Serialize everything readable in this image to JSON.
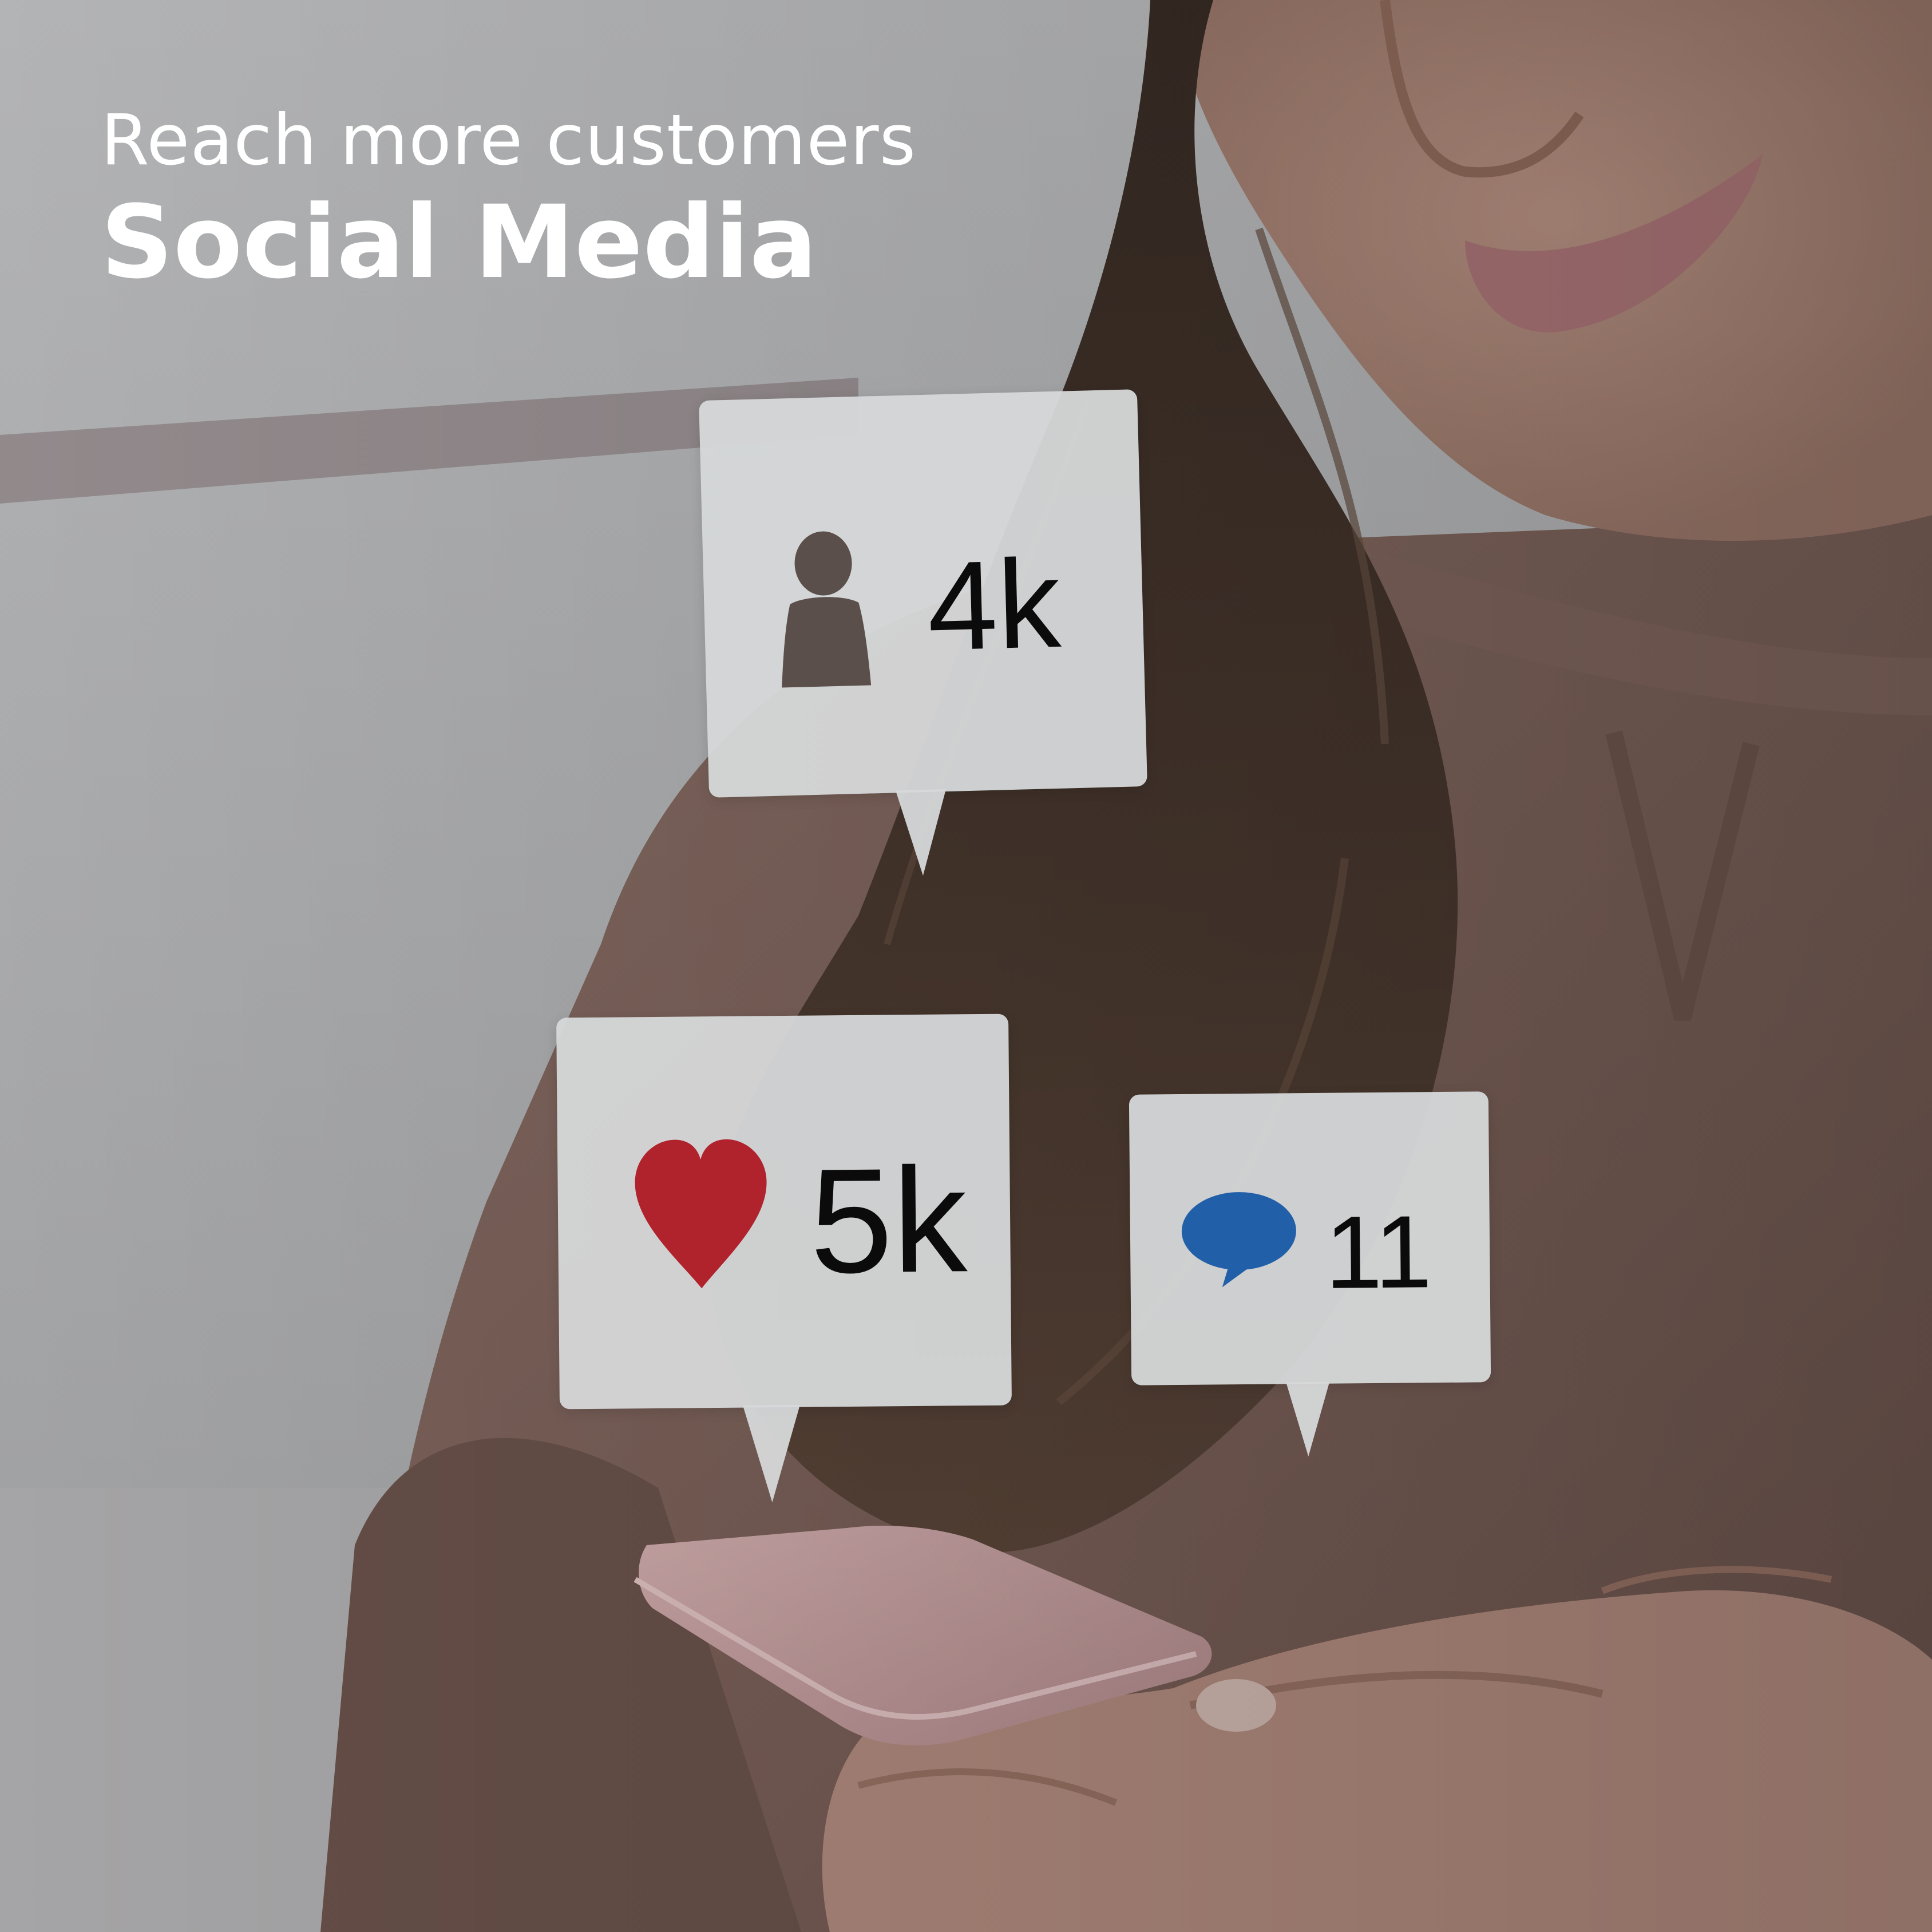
{
  "headline": {
    "subtitle": "Reach more customers",
    "title": "Social Media"
  },
  "bubbles": {
    "followers": {
      "icon": "user-icon",
      "count": "4k",
      "icon_color": "#5a4f4a"
    },
    "likes": {
      "icon": "heart-icon",
      "count": "5k",
      "icon_color": "#b0222c"
    },
    "comments": {
      "icon": "speech-bubble-icon",
      "count": "11",
      "icon_color": "#2160a8"
    }
  }
}
